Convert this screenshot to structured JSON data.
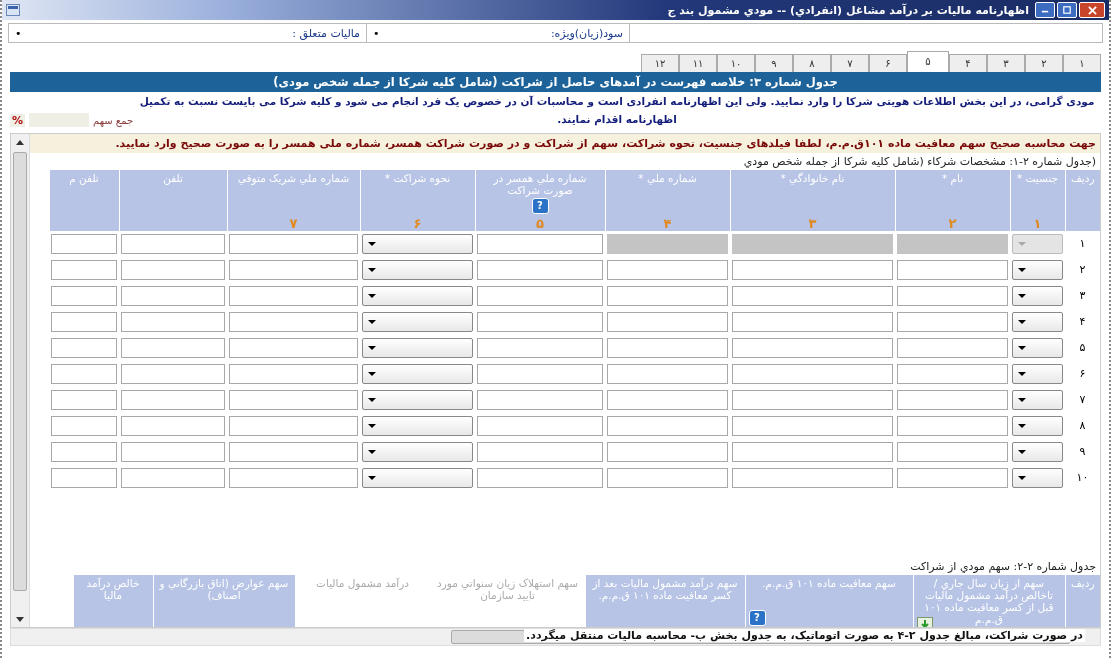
{
  "window": {
    "title": "اظهارنامه ماليات بر درآمد مشاغل (انفرادي) -- مودي مشمول بند ج"
  },
  "summary_fields": [
    {
      "label": "سود(زيان)ويژه:",
      "value": "•"
    },
    {
      "label": "ماليات متعلق :",
      "value": "•"
    }
  ],
  "tabs": [
    {
      "label": "١",
      "selected": false
    },
    {
      "label": "٢",
      "selected": false
    },
    {
      "label": "٣",
      "selected": false
    },
    {
      "label": "۴",
      "selected": false
    },
    {
      "label": "۵",
      "selected": true
    },
    {
      "label": "۶",
      "selected": false
    },
    {
      "label": "٧",
      "selected": false
    },
    {
      "label": "٨",
      "selected": false
    },
    {
      "label": "٩",
      "selected": false
    },
    {
      "label": "١٠",
      "selected": false
    },
    {
      "label": "١١",
      "selected": false
    },
    {
      "label": "١٢",
      "selected": false
    }
  ],
  "section_title": "جدول شماره ۳: خلاصه فهرست در آمدهای حاصل از شراکت (شامل کلیه شرکا از جمله شخص مودی)",
  "notice": "مودی گرامی، در این بخش اطلاعات هویتی شرکا را وارد نمایید. ولی این اظهارنامه انفرادی است و محاسبات آن در خصوص یک فرد انجام می شود و کلیه شرکا می بایست نسبت به تکمیل اظهارنامه اقدام نمایند.",
  "share_total": {
    "label": "جمع سهم",
    "unit": "%"
  },
  "warning": "جهت محاسبه صحیح سهم معافیت ماده ۱۰۱ق.م.م، لطفا فیلدهای جنسیت، نحوه شراکت، سهم از شراکت و در صورت شراکت همسر، شماره ملی همسر را به صورت صحیح وارد نمایید.",
  "partners_table": {
    "caption": "(جدول شماره ۲-۱: مشخصات شرکاء (شامل کلیه شرکا از جمله شخص مودي",
    "columns": [
      {
        "label": "رديف"
      },
      {
        "label": "جنسيت *",
        "number": "١",
        "kind": "dropdown"
      },
      {
        "label": "نام *",
        "number": "٢",
        "kind": "text"
      },
      {
        "label": "نام خانوادگي *",
        "number": "٣",
        "kind": "text"
      },
      {
        "label": "شماره ملي *",
        "number": "۴",
        "kind": "text"
      },
      {
        "label": "شماره ملي همسر در صورت شراکت",
        "number": "۵",
        "kind": "text",
        "badge": "?"
      },
      {
        "label": "نحوه شراکت *",
        "number": "۶",
        "kind": "dropdown"
      },
      {
        "label": "شماره ملي شريک متوفي",
        "number": "٧",
        "kind": "text"
      },
      {
        "label": "تلفن",
        "kind": "text"
      },
      {
        "label": "تلفن م",
        "kind": "text"
      }
    ],
    "rows": [
      {
        "number": "١",
        "cells": [
          {
            "disabled": true
          },
          {
            "disabled": true
          },
          {
            "disabled": true
          },
          {
            "disabled": true
          },
          {
            "disabled": false
          },
          {
            "disabled": false
          },
          {
            "disabled": false
          },
          {
            "disabled": false
          },
          {
            "disabled": false
          }
        ]
      },
      {
        "number": "٢",
        "cells": [
          {
            "disabled": false
          },
          {
            "disabled": false
          },
          {
            "disabled": false
          },
          {
            "disabled": false
          },
          {
            "disabled": false
          },
          {
            "disabled": false
          },
          {
            "disabled": false
          },
          {
            "disabled": false
          },
          {
            "disabled": false
          }
        ]
      },
      {
        "number": "٣",
        "cells": [
          {
            "disabled": false
          },
          {
            "disabled": false
          },
          {
            "disabled": false
          },
          {
            "disabled": false
          },
          {
            "disabled": false
          },
          {
            "disabled": false
          },
          {
            "disabled": false
          },
          {
            "disabled": false
          },
          {
            "disabled": false
          }
        ]
      },
      {
        "number": "۴",
        "cells": [
          {
            "disabled": false
          },
          {
            "disabled": false
          },
          {
            "disabled": false
          },
          {
            "disabled": false
          },
          {
            "disabled": false
          },
          {
            "disabled": false
          },
          {
            "disabled": false
          },
          {
            "disabled": false
          },
          {
            "disabled": false
          }
        ]
      },
      {
        "number": "۵",
        "cells": [
          {
            "disabled": false
          },
          {
            "disabled": false
          },
          {
            "disabled": false
          },
          {
            "disabled": false
          },
          {
            "disabled": false
          },
          {
            "disabled": false
          },
          {
            "disabled": false
          },
          {
            "disabled": false
          },
          {
            "disabled": false
          }
        ]
      },
      {
        "number": "۶",
        "cells": [
          {
            "disabled": false
          },
          {
            "disabled": false
          },
          {
            "disabled": false
          },
          {
            "disabled": false
          },
          {
            "disabled": false
          },
          {
            "disabled": false
          },
          {
            "disabled": false
          },
          {
            "disabled": false
          },
          {
            "disabled": false
          }
        ]
      },
      {
        "number": "٧",
        "cells": [
          {
            "disabled": false
          },
          {
            "disabled": false
          },
          {
            "disabled": false
          },
          {
            "disabled": false
          },
          {
            "disabled": false
          },
          {
            "disabled": false
          },
          {
            "disabled": false
          },
          {
            "disabled": false
          },
          {
            "disabled": false
          }
        ]
      },
      {
        "number": "٨",
        "cells": [
          {
            "disabled": false
          },
          {
            "disabled": false
          },
          {
            "disabled": false
          },
          {
            "disabled": false
          },
          {
            "disabled": false
          },
          {
            "disabled": false
          },
          {
            "disabled": false
          },
          {
            "disabled": false
          },
          {
            "disabled": false
          }
        ]
      },
      {
        "number": "٩",
        "cells": [
          {
            "disabled": false
          },
          {
            "disabled": false
          },
          {
            "disabled": false
          },
          {
            "disabled": false
          },
          {
            "disabled": false
          },
          {
            "disabled": false
          },
          {
            "disabled": false
          },
          {
            "disabled": false
          },
          {
            "disabled": false
          }
        ]
      },
      {
        "number": "١٠",
        "cells": [
          {
            "disabled": false
          },
          {
            "disabled": false
          },
          {
            "disabled": false
          },
          {
            "disabled": false
          },
          {
            "disabled": false
          },
          {
            "disabled": false
          },
          {
            "disabled": false
          },
          {
            "disabled": false
          },
          {
            "disabled": false
          }
        ]
      }
    ]
  },
  "share_table": {
    "caption": "جدول شماره ۲-۲: سهم مودي از شراکت",
    "columns": [
      {
        "label": "رديف",
        "disabled": false,
        "kind": "plain"
      },
      {
        "label": "سهم از زيان سال جاري / تاخالص درآمد مشمول ماليات قبل از کسر معافيت ماده ۱۰۱ ق.م.م",
        "disabled": false,
        "kind": "add"
      },
      {
        "label": "سهم معافيت ماده ۱۰۱ ق.م.م.",
        "disabled": false,
        "kind": "help",
        "badge": "?"
      },
      {
        "label": "سهم درآمد مشمول ماليات بعد از کسر معافيت ماده ۱۰۱ ق.م.م.",
        "disabled": false,
        "kind": "plain"
      },
      {
        "label": "سهم استهلاک زيان سنواتي مورد تاييد سازمان",
        "disabled": true,
        "kind": "plain"
      },
      {
        "label": "درآمد مشمول ماليات",
        "disabled": true,
        "kind": "plain"
      },
      {
        "label": "سهم عوارض (اتاق بازرگاني و اصناف)",
        "disabled": false,
        "kind": "plain"
      },
      {
        "label": "خالص درآمد ماليا",
        "disabled": false,
        "kind": "plain"
      }
    ]
  },
  "footer_note": "در صورت شراکت، مبالغ جدول ۲-۴ به صورت اتوماتیک، به جدول بخش ب- محاسبه مالیات منتقل میگردد."
}
